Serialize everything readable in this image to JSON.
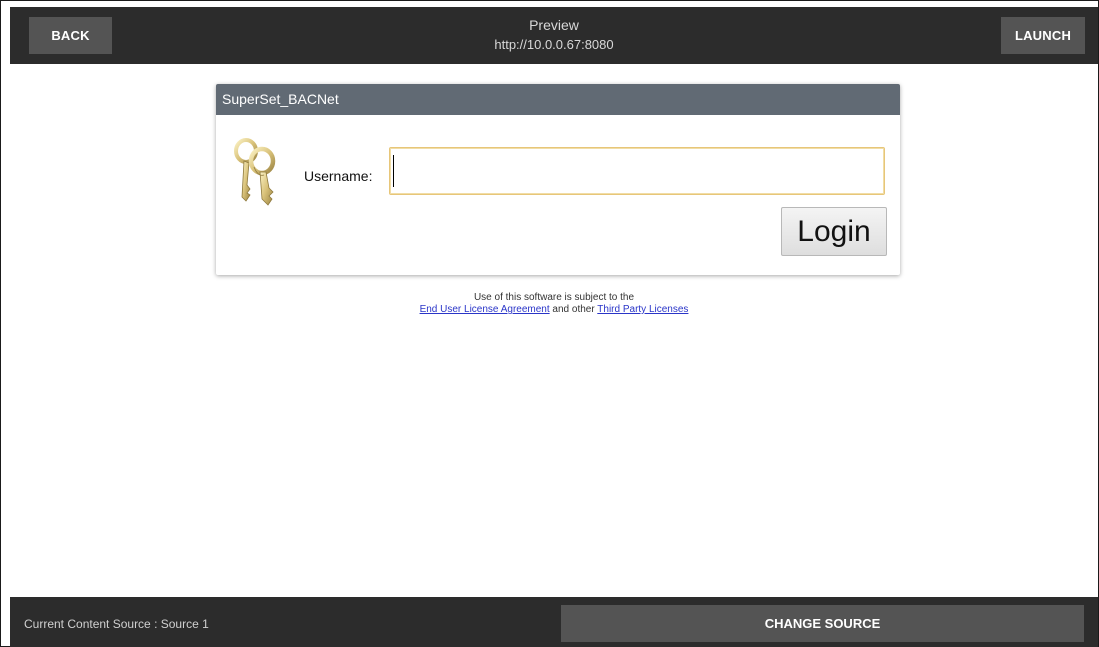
{
  "topbar": {
    "back_label": "BACK",
    "title": "Preview",
    "url": "http://10.0.0.67:8080",
    "launch_label": "LAUNCH"
  },
  "dialog": {
    "title": "SuperSet_BACNet",
    "icon": "keys-icon",
    "username_label": "Username:",
    "username_value": "",
    "login_label": "Login"
  },
  "license": {
    "line1": "Use of this software is subject to the",
    "eula_link": "End User License Agreement",
    "and_other": " and other ",
    "third_party_link": "Third Party Licenses"
  },
  "bottombar": {
    "source_text": "Current Content Source : Source 1",
    "change_label": "CHANGE SOURCE"
  },
  "colors": {
    "bar_bg": "#2c2c2c",
    "button_bg": "#545454",
    "dialog_header": "#616a74",
    "input_border": "#e7c679",
    "link": "#2a35c8"
  }
}
